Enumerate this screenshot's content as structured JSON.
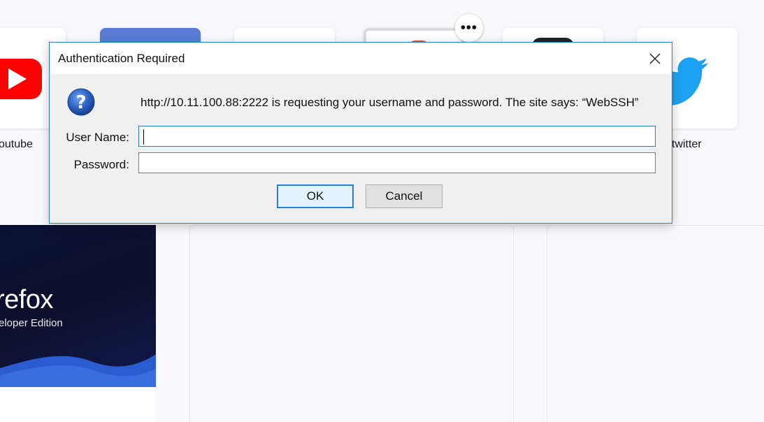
{
  "top_sites": [
    {
      "label": "outube",
      "brand_color": "#ff0000",
      "icon": "youtube-icon"
    },
    {
      "label": "",
      "brand_color": "#5b7bd5",
      "icon": "tile-blue"
    },
    {
      "label": "",
      "brand_color": "#ffffff",
      "icon": "tile-blank"
    },
    {
      "label": "",
      "brand_color": "#e0513a",
      "icon": "tile-partial"
    },
    {
      "label": "",
      "brand_color": "#222222",
      "icon": "tile-dark"
    },
    {
      "label": "twitter",
      "brand_color": "#1da1f2",
      "icon": "twitter-icon"
    }
  ],
  "more_options": {
    "label": "•••"
  },
  "hero": {
    "title": "refox",
    "subtitle": "eloper Edition"
  },
  "dialog": {
    "title": "Authentication Required",
    "message": "http://10.11.100.88:2222 is requesting your username and password. The site says: “WebSSH”",
    "username_label": "User Name:",
    "username_value": "",
    "password_label": "Password:",
    "password_value": "",
    "ok_label": "OK",
    "cancel_label": "Cancel",
    "accent_color": "#2b7fc8"
  }
}
